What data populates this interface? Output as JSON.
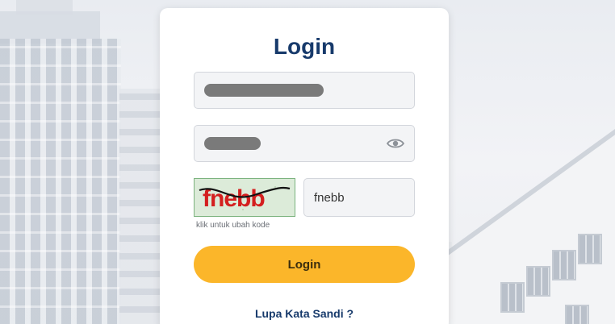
{
  "login": {
    "title": "Login",
    "username_value": "",
    "password_value": "",
    "captcha_image_text": "fnebb",
    "captcha_hint": "klik untuk ubah kode",
    "captcha_input_value": "fnebb",
    "submit_label": "Login",
    "forgot_link": "Lupa Kata Sandi ?"
  },
  "icons": {
    "password_toggle": "eye-icon"
  },
  "colors": {
    "title": "#173a6b",
    "button": "#fbb62a",
    "field_bg": "#f3f4f6",
    "captcha_text": "#d41f1f"
  }
}
